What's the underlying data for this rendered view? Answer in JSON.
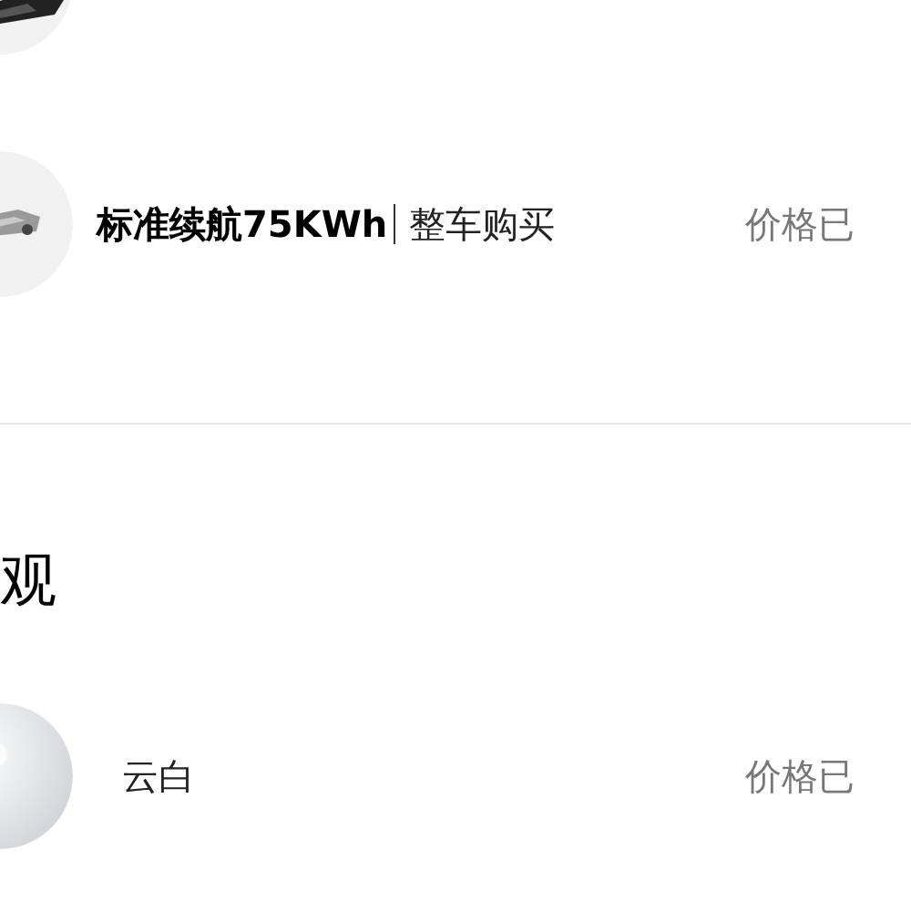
{
  "versions": [
    {
      "kind": "picture"
    },
    {
      "kind": "picture",
      "name": "标准续航75KWh",
      "purchase": "整车购买",
      "price": "价格已"
    }
  ],
  "section": {
    "title": "观"
  },
  "colors": [
    {
      "kind": "picture",
      "name": "云白",
      "price": "价格已"
    }
  ]
}
